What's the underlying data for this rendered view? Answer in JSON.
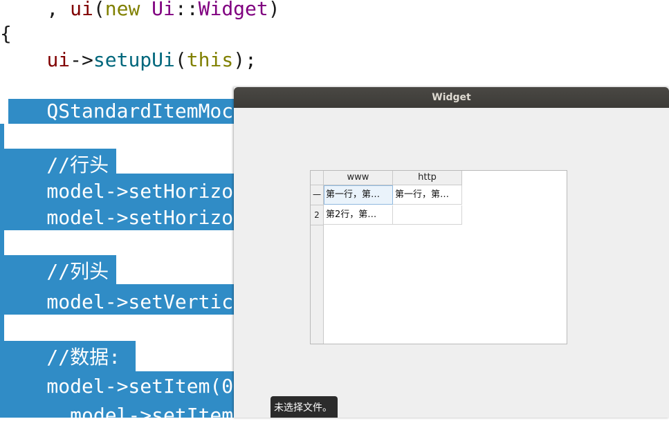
{
  "editor": {
    "lines": [
      {
        "parts": [
          {
            "t": "    , ",
            "c": ""
          },
          {
            "t": "ui",
            "c": "var"
          },
          {
            "t": "(",
            "c": ""
          },
          {
            "t": "new",
            "c": "kw"
          },
          {
            "t": " ",
            "c": ""
          },
          {
            "t": "Ui",
            "c": "typ"
          },
          {
            "t": "::",
            "c": ""
          },
          {
            "t": "Widget",
            "c": "typ"
          },
          {
            "t": ")",
            "c": ""
          }
        ]
      },
      {
        "parts": [
          {
            "t": "{",
            "c": ""
          }
        ]
      },
      {
        "parts": [
          {
            "t": "    ",
            "c": ""
          },
          {
            "t": "ui",
            "c": "var"
          },
          {
            "t": "->",
            "c": ""
          },
          {
            "t": "setupUi",
            "c": "fn"
          },
          {
            "t": "(",
            "c": ""
          },
          {
            "t": "this",
            "c": "kw"
          },
          {
            "t": ");",
            "c": ""
          }
        ]
      },
      {
        "parts": []
      },
      {
        "parts": [
          {
            "t": "    QStandardItemMoc",
            "c": "sel-text"
          }
        ]
      },
      {
        "parts": []
      },
      {
        "parts": [
          {
            "t": "    //行头",
            "c": "sel-text"
          }
        ]
      },
      {
        "parts": [
          {
            "t": "    model->setHorizo",
            "c": "sel-text"
          }
        ]
      },
      {
        "parts": [
          {
            "t": "    model->setHorizo",
            "c": "sel-text"
          }
        ]
      },
      {
        "parts": []
      },
      {
        "parts": [
          {
            "t": "    //列头",
            "c": "sel-text"
          }
        ]
      },
      {
        "parts": [
          {
            "t": "    model->setVertic",
            "c": "sel-text"
          }
        ]
      },
      {
        "parts": []
      },
      {
        "parts": [
          {
            "t": "    //数据:",
            "c": "sel-text"
          }
        ]
      },
      {
        "parts": [
          {
            "t": "    model->setItem(0",
            "c": "sel-text"
          }
        ]
      },
      {
        "parts": [
          {
            "t": "      model->setItem",
            "c": "sel-text"
          }
        ]
      }
    ]
  },
  "window": {
    "title": "Widget",
    "table": {
      "headers": [
        "www",
        "http"
      ],
      "row_headers": [
        "一",
        "2"
      ],
      "rows": [
        [
          "第一行，第…",
          "第一行，第…"
        ],
        [
          "第2行，第…",
          ""
        ]
      ]
    }
  },
  "tooltip": {
    "text": "未选择文件。"
  },
  "colors": {
    "selection": "#308cc6",
    "titlebar": "#3c3b37",
    "window_bg": "#efefef",
    "keyword": "#808000",
    "type": "#800080",
    "function": "#00677c",
    "variable": "#800000"
  }
}
